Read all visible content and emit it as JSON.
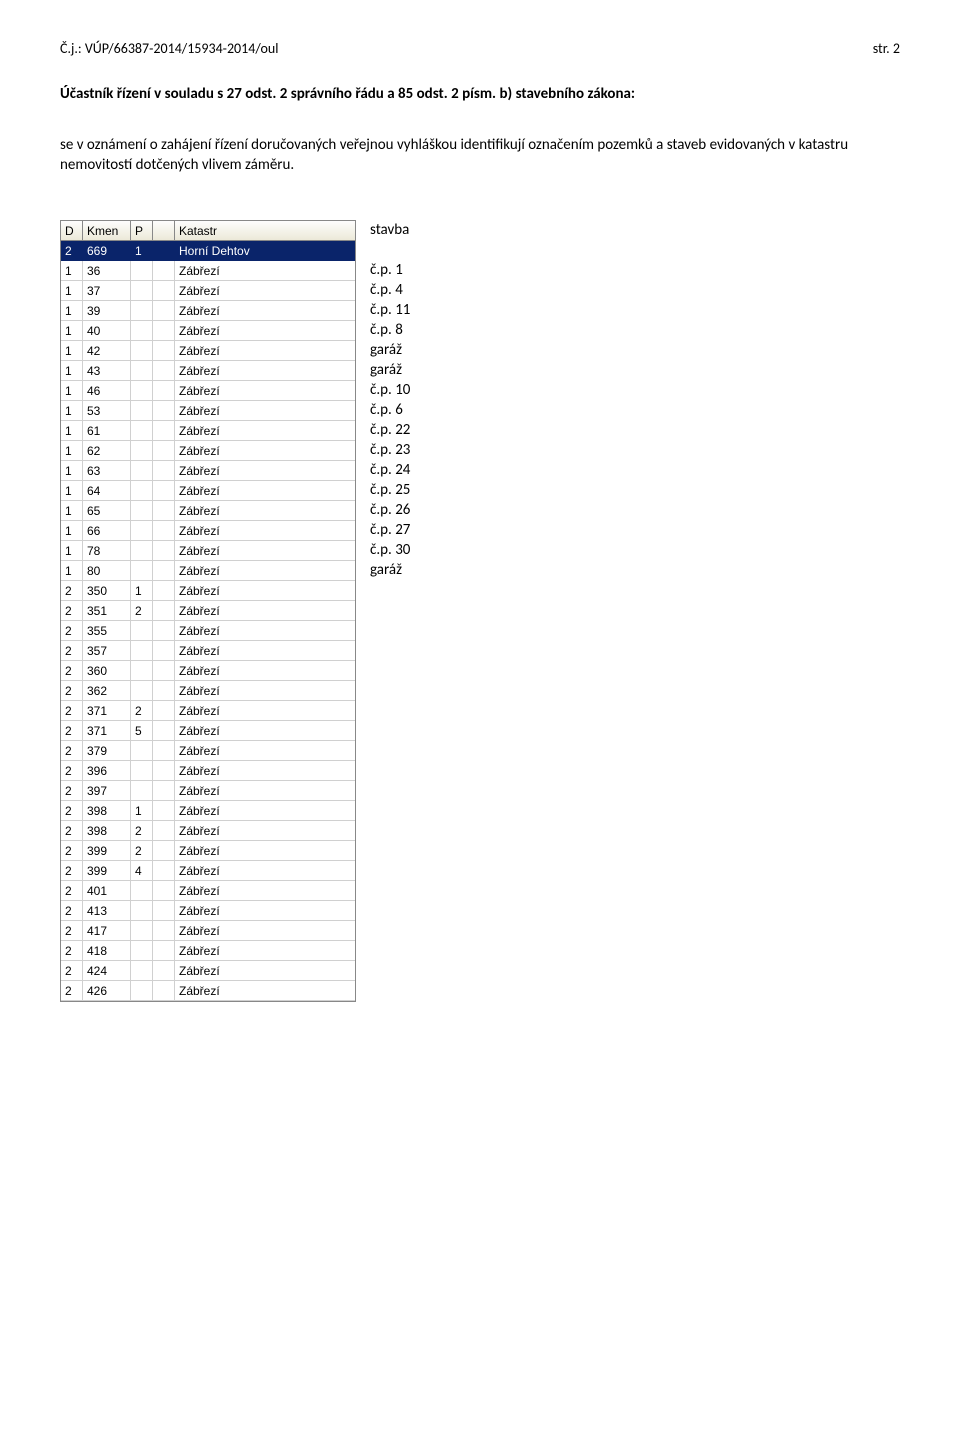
{
  "header": {
    "case_no_label": "Č.j.:",
    "case_no_value": "VÚP/66387-2014/15934-2014/oul",
    "page_label": "str.",
    "page_no": "2"
  },
  "paragraph1_parts": {
    "p1": "Účastník řízení v souladu s 27 odst. 2 správního řádu a 85 odst. 2 písm.",
    "p2": "b) stavebního zákona:"
  },
  "paragraph2": "se v oznámení o zahájení řízení doručovaných veřejnou vyhláškou identifikují označením pozemků a staveb evidovaných v katastru nemovitostí dotčených vlivem záměru.",
  "grid": {
    "columns": [
      "D",
      "Kmen",
      "P",
      "",
      "Katastr"
    ],
    "rows": [
      {
        "d": "2",
        "kmen": "669",
        "p": "1",
        "gap": "",
        "katastr": "Horní Dehtov",
        "selected": true
      },
      {
        "d": "1",
        "kmen": "36",
        "p": "",
        "gap": "",
        "katastr": "Zábřezí"
      },
      {
        "d": "1",
        "kmen": "37",
        "p": "",
        "gap": "",
        "katastr": "Zábřezí"
      },
      {
        "d": "1",
        "kmen": "39",
        "p": "",
        "gap": "",
        "katastr": "Zábřezí"
      },
      {
        "d": "1",
        "kmen": "40",
        "p": "",
        "gap": "",
        "katastr": "Zábřezí"
      },
      {
        "d": "1",
        "kmen": "42",
        "p": "",
        "gap": "",
        "katastr": "Zábřezí"
      },
      {
        "d": "1",
        "kmen": "43",
        "p": "",
        "gap": "",
        "katastr": "Zábřezí"
      },
      {
        "d": "1",
        "kmen": "46",
        "p": "",
        "gap": "",
        "katastr": "Zábřezí"
      },
      {
        "d": "1",
        "kmen": "53",
        "p": "",
        "gap": "",
        "katastr": "Zábřezí"
      },
      {
        "d": "1",
        "kmen": "61",
        "p": "",
        "gap": "",
        "katastr": "Zábřezí"
      },
      {
        "d": "1",
        "kmen": "62",
        "p": "",
        "gap": "",
        "katastr": "Zábřezí"
      },
      {
        "d": "1",
        "kmen": "63",
        "p": "",
        "gap": "",
        "katastr": "Zábřezí"
      },
      {
        "d": "1",
        "kmen": "64",
        "p": "",
        "gap": "",
        "katastr": "Zábřezí"
      },
      {
        "d": "1",
        "kmen": "65",
        "p": "",
        "gap": "",
        "katastr": "Zábřezí"
      },
      {
        "d": "1",
        "kmen": "66",
        "p": "",
        "gap": "",
        "katastr": "Zábřezí"
      },
      {
        "d": "1",
        "kmen": "78",
        "p": "",
        "gap": "",
        "katastr": "Zábřezí"
      },
      {
        "d": "1",
        "kmen": "80",
        "p": "",
        "gap": "",
        "katastr": "Zábřezí"
      },
      {
        "d": "2",
        "kmen": "350",
        "p": "1",
        "gap": "",
        "katastr": "Zábřezí"
      },
      {
        "d": "2",
        "kmen": "351",
        "p": "2",
        "gap": "",
        "katastr": "Zábřezí"
      },
      {
        "d": "2",
        "kmen": "355",
        "p": "",
        "gap": "",
        "katastr": "Zábřezí"
      },
      {
        "d": "2",
        "kmen": "357",
        "p": "",
        "gap": "",
        "katastr": "Zábřezí"
      },
      {
        "d": "2",
        "kmen": "360",
        "p": "",
        "gap": "",
        "katastr": "Zábřezí"
      },
      {
        "d": "2",
        "kmen": "362",
        "p": "",
        "gap": "",
        "katastr": "Zábřezí"
      },
      {
        "d": "2",
        "kmen": "371",
        "p": "2",
        "gap": "",
        "katastr": "Zábřezí"
      },
      {
        "d": "2",
        "kmen": "371",
        "p": "5",
        "gap": "",
        "katastr": "Zábřezí"
      },
      {
        "d": "2",
        "kmen": "379",
        "p": "",
        "gap": "",
        "katastr": "Zábřezí"
      },
      {
        "d": "2",
        "kmen": "396",
        "p": "",
        "gap": "",
        "katastr": "Zábřezí"
      },
      {
        "d": "2",
        "kmen": "397",
        "p": "",
        "gap": "",
        "katastr": "Zábřezí"
      },
      {
        "d": "2",
        "kmen": "398",
        "p": "1",
        "gap": "",
        "katastr": "Zábřezí"
      },
      {
        "d": "2",
        "kmen": "398",
        "p": "2",
        "gap": "",
        "katastr": "Zábřezí"
      },
      {
        "d": "2",
        "kmen": "399",
        "p": "2",
        "gap": "",
        "katastr": "Zábřezí"
      },
      {
        "d": "2",
        "kmen": "399",
        "p": "4",
        "gap": "",
        "katastr": "Zábřezí"
      },
      {
        "d": "2",
        "kmen": "401",
        "p": "",
        "gap": "",
        "katastr": "Zábřezí"
      },
      {
        "d": "2",
        "kmen": "413",
        "p": "",
        "gap": "",
        "katastr": "Zábřezí"
      },
      {
        "d": "2",
        "kmen": "417",
        "p": "",
        "gap": "",
        "katastr": "Zábřezí"
      },
      {
        "d": "2",
        "kmen": "418",
        "p": "",
        "gap": "",
        "katastr": "Zábřezí"
      },
      {
        "d": "2",
        "kmen": "424",
        "p": "",
        "gap": "",
        "katastr": "Zábřezí"
      },
      {
        "d": "2",
        "kmen": "426",
        "p": "",
        "gap": "",
        "katastr": "Zábřezí"
      }
    ]
  },
  "labels": {
    "head": "stavba",
    "items": [
      "",
      "č.p. 1",
      "č.p. 4",
      "č.p. 11",
      "č.p. 8",
      "garáž",
      "garáž",
      "č.p. 10",
      "č.p. 6",
      "č.p. 22",
      "č.p. 23",
      "č.p. 24",
      "č.p. 25",
      "č.p. 26",
      "č.p. 27",
      "č.p. 30",
      "garáž"
    ]
  }
}
